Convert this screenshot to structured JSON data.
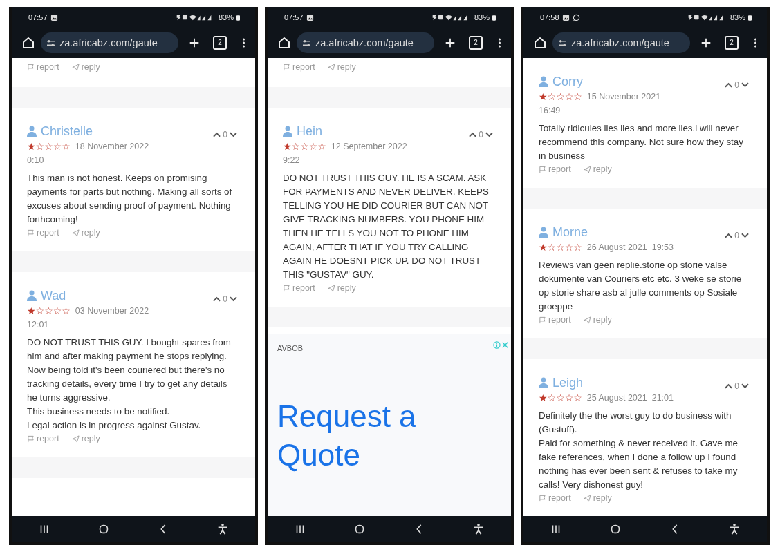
{
  "phones": [
    {
      "status_bar": {
        "time": "07:57",
        "notifications": [
          {
            "kind": "image"
          }
        ],
        "battery": "83%"
      },
      "browser": {
        "url": "za.africabz.com/gaute",
        "tab_count": "2"
      },
      "feed": [
        {
          "kind": "actions",
          "report": "report",
          "reply": "reply"
        },
        {
          "kind": "gap"
        },
        {
          "kind": "review",
          "name": "Christelle",
          "stars": 1,
          "date": "18 November 2022",
          "time": "0:10",
          "votes": "0",
          "text": "This man is not honest. Keeps on promising payments for parts but nothing. Making all sorts of excuses about sending proof of payment. Nothing forthcoming!",
          "report": "report",
          "reply": "reply"
        },
        {
          "kind": "gap"
        },
        {
          "kind": "review",
          "name": "Wad",
          "stars": 1,
          "date": "03 November 2022",
          "time": "12:01",
          "votes": "0",
          "text": "DO NOT TRUST THIS GUY. I bought spares from him and after making payment he stops replying. Now being told it's been couriered but there's no tracking details, every time I try to get any details he turns aggressive.\nThis business needs to be notified.\nLegal action is in progress against Gustav.",
          "report": "report",
          "reply": "reply"
        },
        {
          "kind": "gap"
        }
      ]
    },
    {
      "status_bar": {
        "time": "07:57",
        "notifications": [
          {
            "kind": "image"
          }
        ],
        "battery": "83%"
      },
      "browser": {
        "url": "za.africabz.com/gaute",
        "tab_count": "2"
      },
      "feed": [
        {
          "kind": "actions",
          "report": "report",
          "reply": "reply"
        },
        {
          "kind": "gap"
        },
        {
          "kind": "review",
          "name": "Hein",
          "stars": 1,
          "date": "12 September 2022",
          "time": "9:22",
          "votes": "0",
          "text": "DO NOT TRUST THIS GUY. HE IS A SCAM. ASK FOR PAYMENTS AND NEVER DELIVER, KEEPS TELLING YOU HE DID COURIER BUT CAN NOT GIVE TRACKING NUMBERS. YOU PHONE HIM THEN HE TELLS YOU NOT TO PHONE HIM AGAIN, AFTER THAT IF YOU TRY CALLING AGAIN HE DOESNT PICK UP. DO NOT TRUST THIS \"GUSTAV\" GUY.",
          "report": "report",
          "reply": "reply"
        },
        {
          "kind": "gap"
        },
        {
          "kind": "ad",
          "advertiser": "AVBOB",
          "headline": "Request a Quote"
        }
      ]
    },
    {
      "status_bar": {
        "time": "07:58",
        "notifications": [
          {
            "kind": "image"
          },
          {
            "kind": "chat"
          }
        ],
        "battery": "83%"
      },
      "browser": {
        "url": "za.africabz.com/gaute",
        "tab_count": "2"
      },
      "feed": [
        {
          "kind": "review",
          "name": "Corry",
          "stars": 1,
          "date": "15 November 2021",
          "time": "16:49",
          "votes": "0",
          "text": "Totally ridicules lies lies and more lies.i will never recommend this company. Not sure how they stay in business",
          "report": "report",
          "reply": "reply"
        },
        {
          "kind": "gap"
        },
        {
          "kind": "review",
          "name": "Morne",
          "stars": 1,
          "date": "26 August 2021",
          "time": "19:53",
          "votes": "0",
          "text": "Reviews van geen replie.storie op storie valse dokumente van Couriers etc etc. 3 weke se storie op storie share asb al julle comments op Sosiale groeppe",
          "report": "report",
          "reply": "reply"
        },
        {
          "kind": "gap"
        },
        {
          "kind": "review",
          "name": "Leigh",
          "stars": 1,
          "date": "25 August 2021",
          "time": "21:01",
          "votes": "0",
          "text": "Definitely the the worst guy to do business with (Gustuff).\nPaid for something & never received it. Gave me fake references, when I done a follow up I found nothing has ever been sent & refuses to take my calls! Very dishonest guy!",
          "report": "report",
          "reply": "reply"
        }
      ]
    }
  ]
}
